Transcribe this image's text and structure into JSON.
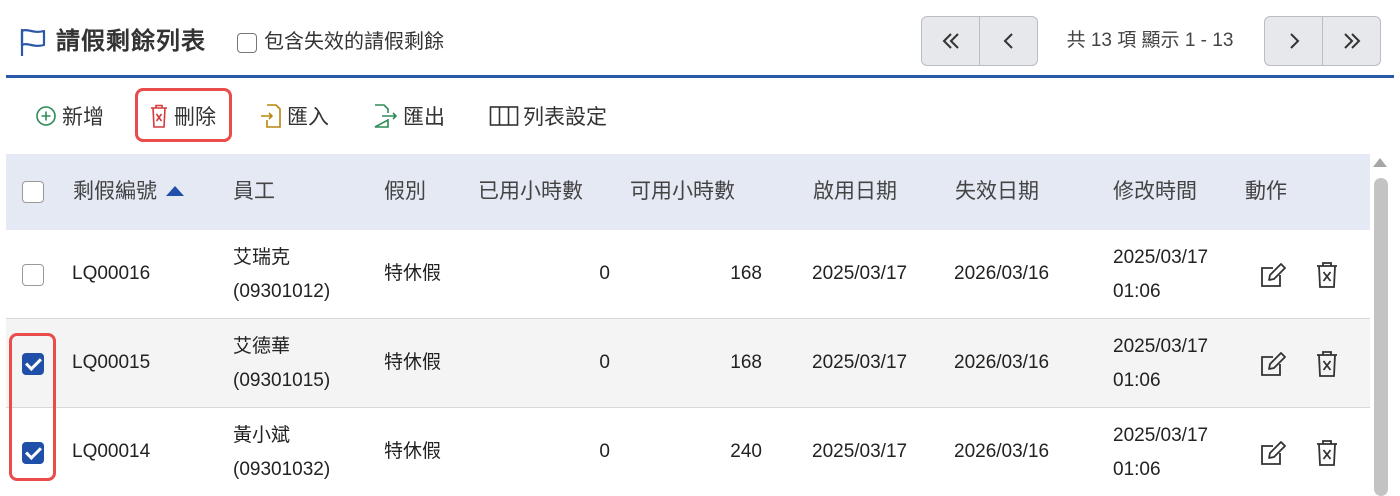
{
  "header": {
    "title": "請假剩餘列表",
    "flag_icon": "flag-icon",
    "include_expired": {
      "label": "包含失效的請假剩餘",
      "checked": false
    }
  },
  "pager": {
    "first": "«",
    "prev": "‹",
    "info": "共 13 項 顯示 1 - 13",
    "next": "›",
    "last": "»"
  },
  "toolbar": {
    "add": "新增",
    "delete": "刪除",
    "import": "匯入",
    "export": "匯出",
    "column_settings": "列表設定"
  },
  "table": {
    "columns": {
      "id": "剩假編號",
      "employee": "員工",
      "leave_type": "假別",
      "used_hours": "已用小時數",
      "available_hours": "可用小時數",
      "start_date": "啟用日期",
      "end_date": "失效日期",
      "modified": "修改時間",
      "actions": "動作"
    },
    "sort": {
      "column": "id",
      "direction": "ascending"
    },
    "rows": [
      {
        "checked": false,
        "id": "LQ00016",
        "name": "艾瑞克",
        "emp_no": "(09301012)",
        "leave_type": "特休假",
        "used": "0",
        "available": "168",
        "start": "2025/03/17",
        "end": "2026/03/16",
        "mod_date": "2025/03/17",
        "mod_time": "01:06"
      },
      {
        "checked": true,
        "id": "LQ00015",
        "name": "艾德華",
        "emp_no": "(09301015)",
        "leave_type": "特休假",
        "used": "0",
        "available": "168",
        "start": "2025/03/17",
        "end": "2026/03/16",
        "mod_date": "2025/03/17",
        "mod_time": "01:06"
      },
      {
        "checked": true,
        "id": "LQ00014",
        "name": "黃小斌",
        "emp_no": "(09301032)",
        "leave_type": "特休假",
        "used": "0",
        "available": "240",
        "start": "2025/03/17",
        "end": "2026/03/16",
        "mod_date": "2025/03/17",
        "mod_time": "01:06"
      }
    ]
  },
  "colors": {
    "accent": "#2b58a6",
    "checkbox_checked": "#1f4fa8",
    "highlight": "#ea4b4b",
    "header_bg": "#e4e9f4"
  }
}
